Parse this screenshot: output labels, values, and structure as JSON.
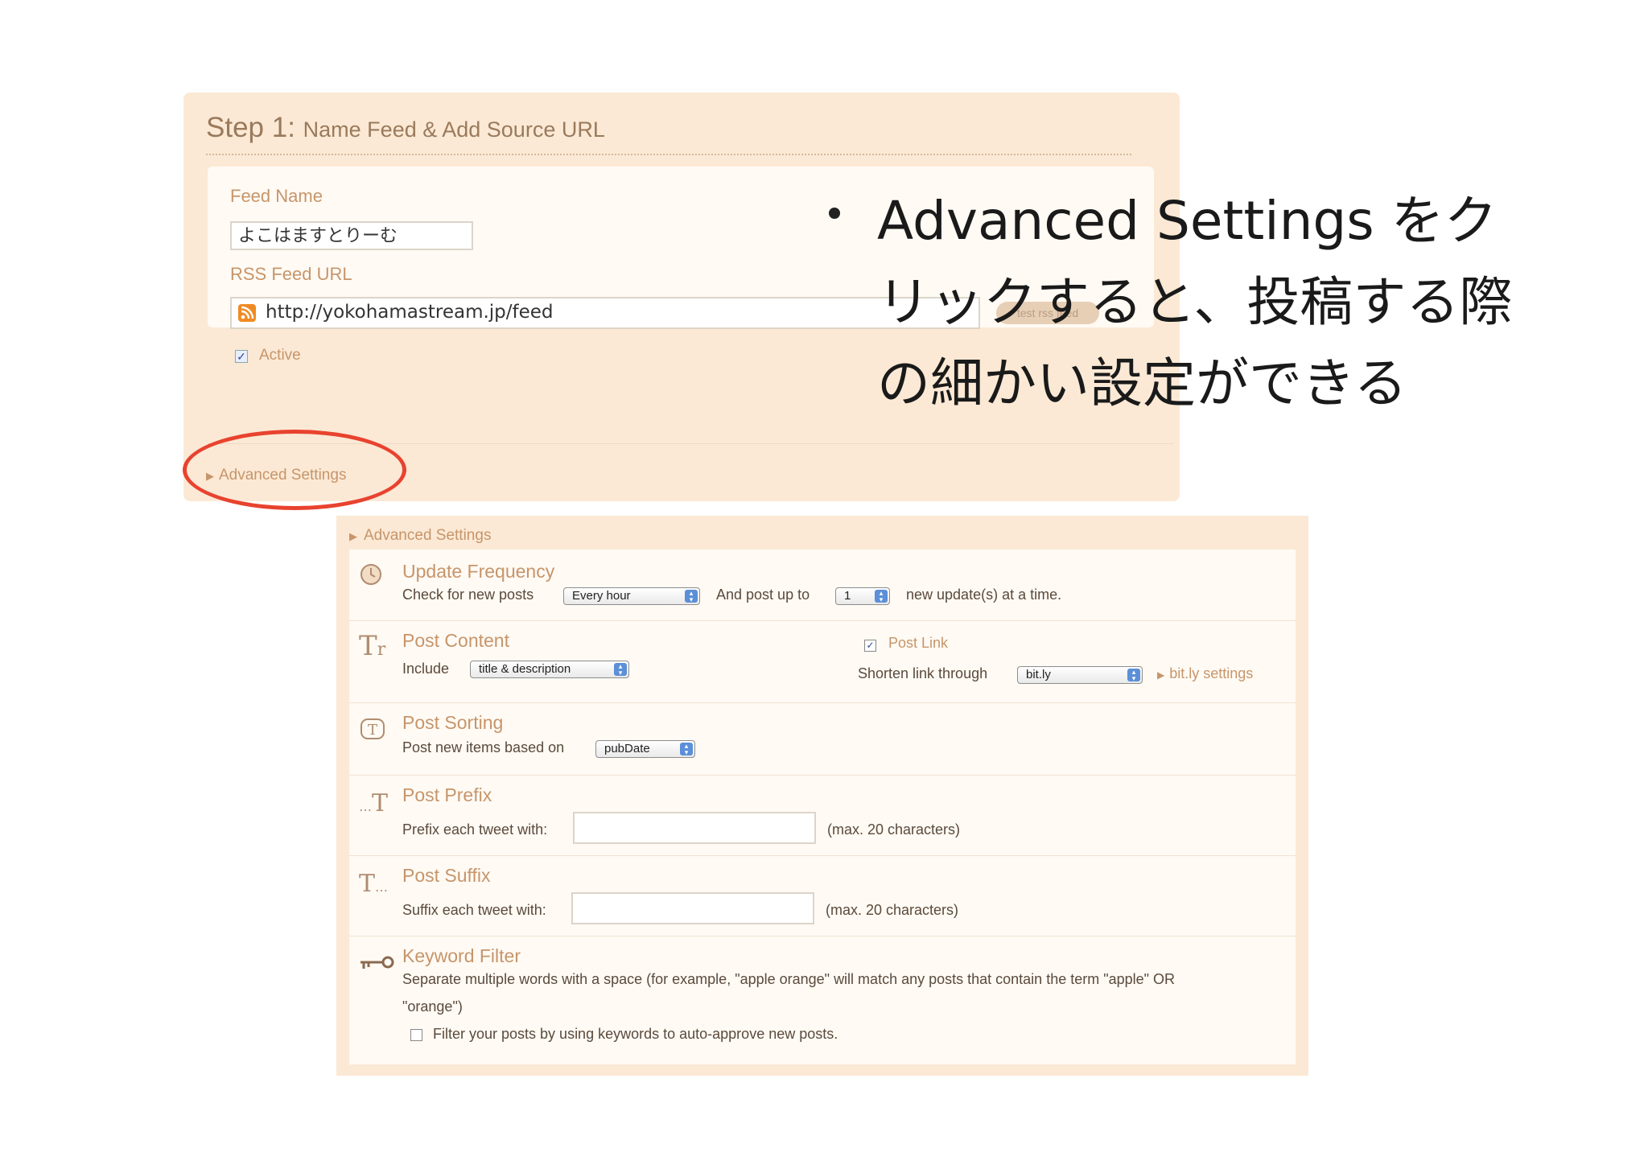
{
  "step1": {
    "title_step": "Step 1:",
    "title_rest": "Name Feed & Add Source URL",
    "feed_name_label": "Feed Name",
    "feed_name_value": "よこはますとりーむ",
    "rss_label": "RSS Feed URL",
    "rss_value": "http://yokohamastream.jp/feed",
    "test_button": "test rss feed",
    "active_label": "Active",
    "active_checked": true,
    "advanced_toggle": "Advanced Settings"
  },
  "slide": {
    "bullet_text": "Advanced Settings をクリックすると、投稿する際の細かい設定ができる"
  },
  "advanced": {
    "header": "Advanced Settings",
    "update_frequency": {
      "title": "Update Frequency",
      "check_label": "Check for new posts",
      "frequency_value": "Every hour",
      "post_up_label": "And post up to",
      "count_value": "1",
      "suffix": "new update(s) at a time."
    },
    "post_content": {
      "title": "Post Content",
      "include_label": "Include",
      "include_value": "title & description",
      "post_link_label": "Post Link",
      "post_link_checked": true,
      "shorten_label": "Shorten link through",
      "shorten_value": "bit.ly",
      "bitly_link": "bit.ly settings"
    },
    "post_sorting": {
      "title": "Post Sorting",
      "label": "Post new items based on",
      "value": "pubDate"
    },
    "post_prefix": {
      "title": "Post Prefix",
      "label": "Prefix each tweet with:",
      "value": "",
      "hint": "(max. 20 characters)"
    },
    "post_suffix": {
      "title": "Post Suffix",
      "label": "Suffix each tweet with:",
      "value": "",
      "hint": "(max. 20 characters)"
    },
    "keyword_filter": {
      "title": "Keyword Filter",
      "description_line1": "Separate multiple words with a space (for example, \"apple orange\" will match any posts that contain the term \"apple\" OR",
      "description_line2": "\"orange\")",
      "checkbox_label": "Filter your posts by using keywords to auto-approve new posts.",
      "checked": false
    }
  }
}
